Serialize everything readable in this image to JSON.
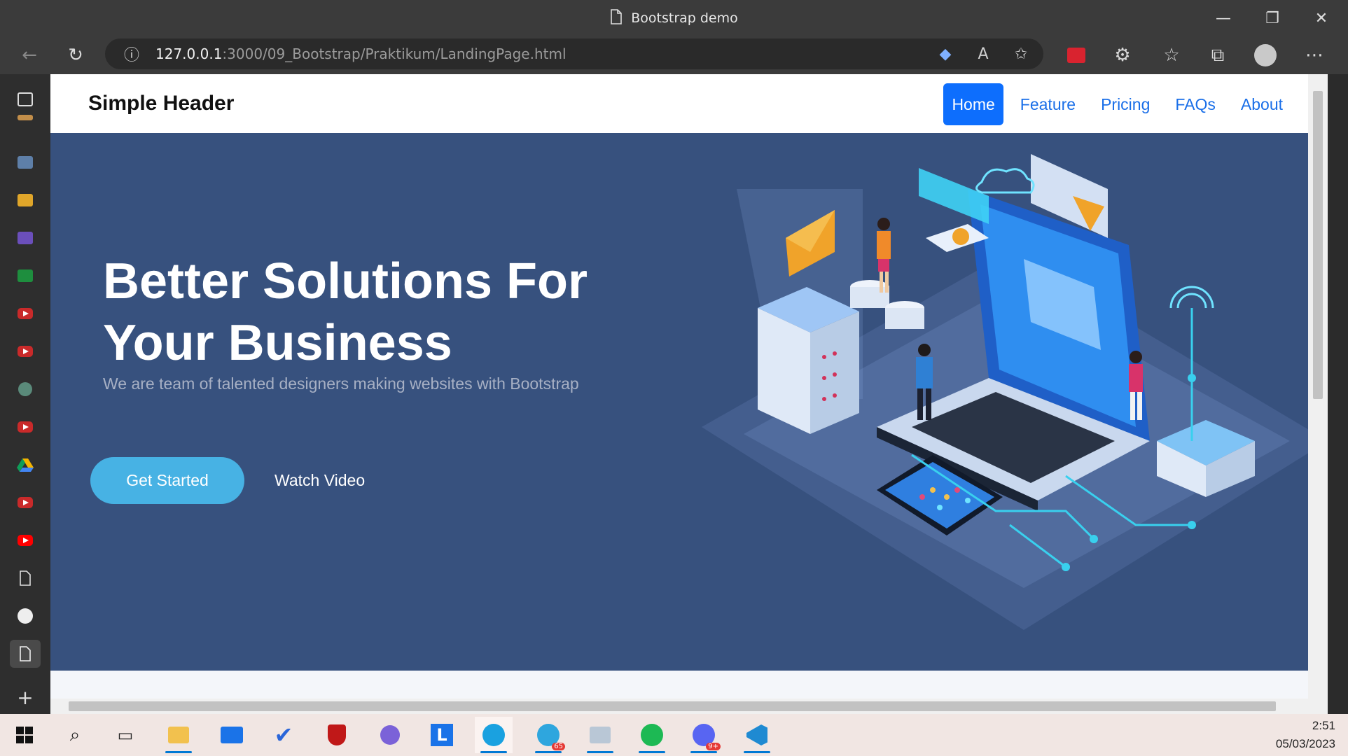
{
  "window": {
    "title": "Bootstrap demo"
  },
  "browser": {
    "url_host": "127.0.0.1",
    "url_rest": ":3000/09_Bootstrap/Praktikum/LandingPage.html"
  },
  "page": {
    "brand": "Simple Header",
    "nav": [
      "Home",
      "Feature",
      "Pricing",
      "FAQs",
      "About"
    ],
    "hero": {
      "title": "Better Solutions For Your Business",
      "subtitle": "We are team of talented designers making websites with Bootstrap",
      "primary_button": "Get Started",
      "secondary_button": "Watch Video"
    }
  },
  "taskbar": {
    "time": "2:51",
    "date": "05/03/2023",
    "telegram_badge": "65",
    "discord_badge": "9+"
  },
  "colors": {
    "hero_bg": "#37517e",
    "accent": "#47b2e4",
    "nav_active": "#0d6efd"
  }
}
